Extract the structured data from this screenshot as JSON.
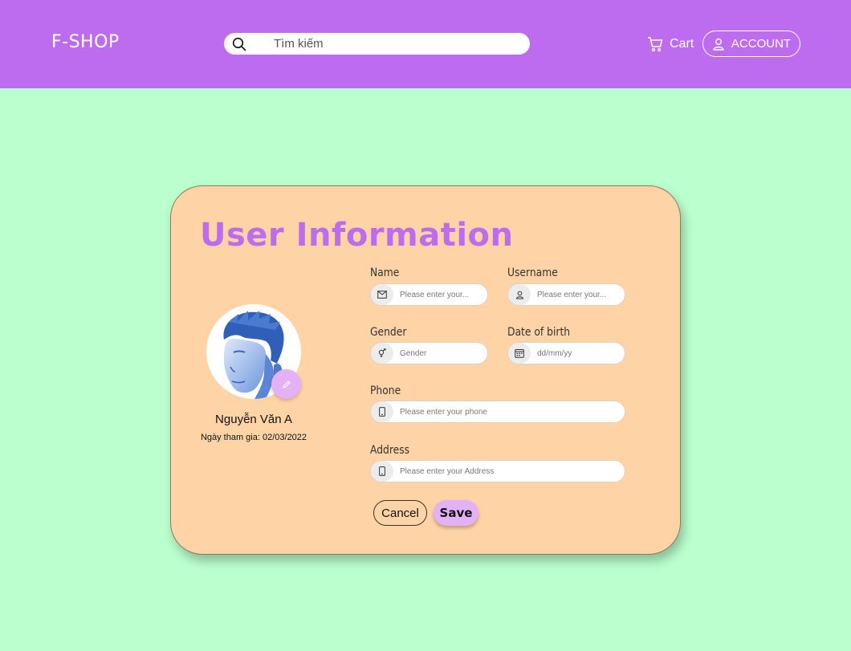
{
  "header": {
    "logo": "F-SHOP",
    "search_placeholder": "Tìm kiếm",
    "cart_label": "Cart",
    "account_label": "ACCOUNT"
  },
  "colors": {
    "header_bg": "#bd6cef",
    "page_bg": "#baffcd",
    "card_bg": "#fed4a6",
    "accent": "#bd6cef",
    "button_accent": "#e3b1f6"
  },
  "card": {
    "title": "User Information",
    "profile": {
      "name": "Nguyễn Văn A",
      "join_label": "Ngày tham gia:",
      "join_date": "02/03/2022"
    },
    "fields": {
      "name": {
        "label": "Name",
        "placeholder": "Please enter your...",
        "icon": "mail-icon"
      },
      "username": {
        "label": "Username",
        "placeholder": "Please enter your...",
        "icon": "user-icon"
      },
      "gender": {
        "label": "Gender",
        "placeholder": "Gender",
        "icon": "gender-icon"
      },
      "dob": {
        "label": "Date of birth",
        "placeholder": "dd/mm/yy",
        "icon": "calendar-icon"
      },
      "phone": {
        "label": "Phone",
        "placeholder": "Please enter your phone",
        "icon": "phone-icon"
      },
      "address": {
        "label": "Address",
        "placeholder": "Please enter your Address",
        "icon": "phone-icon"
      }
    },
    "buttons": {
      "cancel": "Cancel",
      "save": "Save"
    }
  }
}
